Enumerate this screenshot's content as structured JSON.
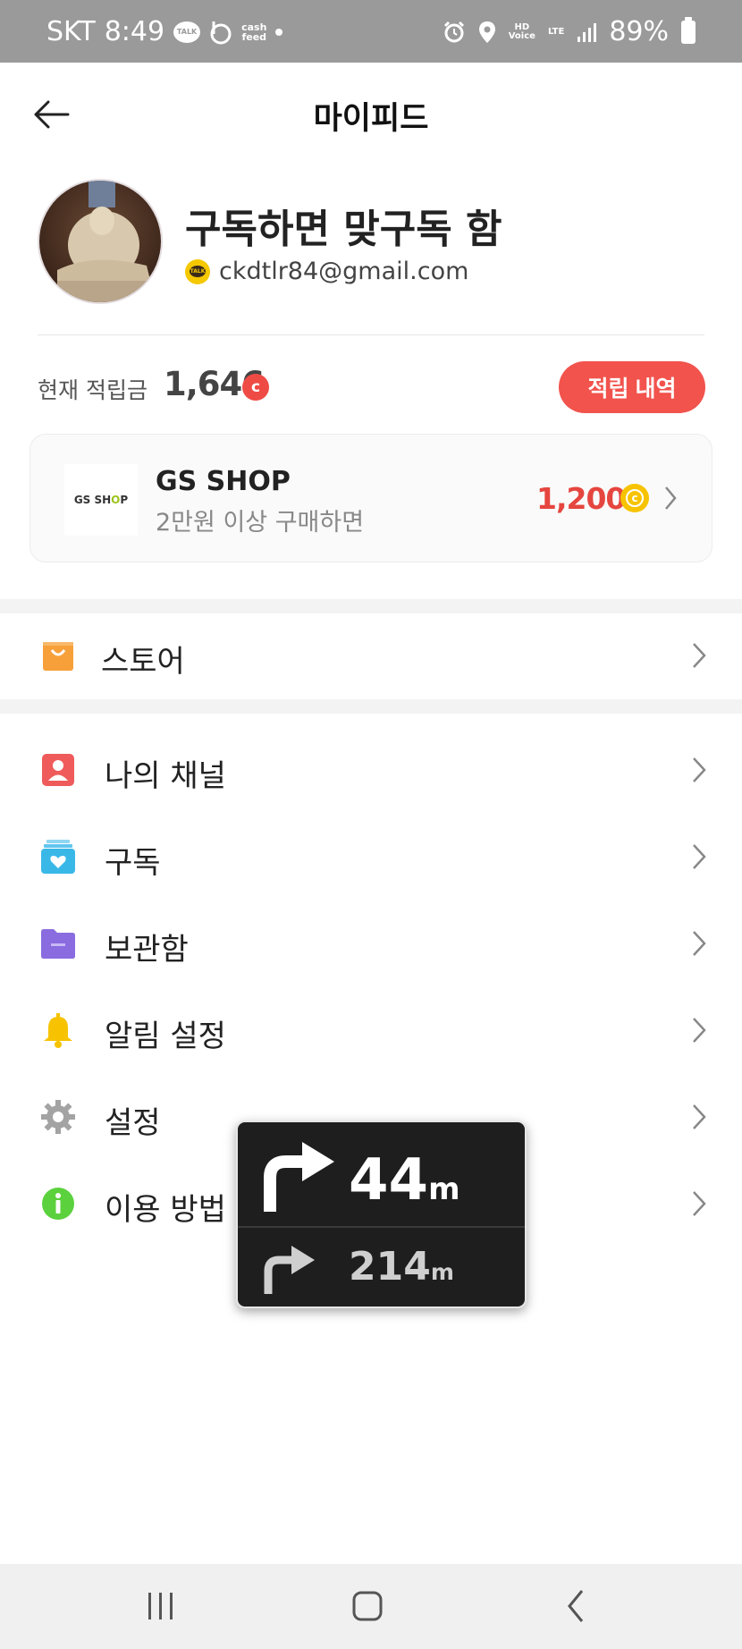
{
  "status_bar": {
    "carrier": "SKT",
    "time": "8:49",
    "talk_icon_text": "TALK",
    "cashfeed_text": "cash\nfeed",
    "hd_voice": "HD Voice",
    "network": "LTE",
    "battery": "89%"
  },
  "header": {
    "title": "마이피드"
  },
  "profile": {
    "name": "구독하면 맞구독 함",
    "talk_badge": "TALK",
    "email": "ckdtlr84@gmail.com"
  },
  "points": {
    "label": "현재 적립금",
    "value": "1,646",
    "coin_symbol": "c",
    "history_button": "적립 내역"
  },
  "promo_card": {
    "logo_text_1": "GS SH",
    "logo_text_2": "O",
    "logo_text_3": "P",
    "shop_name": "GS SHOP",
    "description": "2만원 이상 구매하면",
    "reward": "1,200",
    "coin_symbol": "c"
  },
  "store": {
    "label": "스토어",
    "icon": "shopping-bag-icon",
    "color": "#f7a03a"
  },
  "menu": [
    {
      "label": "나의 채널",
      "icon": "person-icon",
      "color": "#ef5b5b"
    },
    {
      "label": "구독",
      "icon": "subscription-heart-icon",
      "color": "#39b8e8"
    },
    {
      "label": "보관함",
      "icon": "folder-icon",
      "color": "#8a6be0"
    },
    {
      "label": "알림 설정",
      "icon": "bell-icon",
      "color": "#f7c300"
    },
    {
      "label": "설정",
      "icon": "gear-icon",
      "color": "#a3a3a3"
    },
    {
      "label": "이용 방법",
      "icon": "info-icon",
      "color": "#5bd13d"
    }
  ],
  "nav_overlay": {
    "distance_1": "44",
    "unit_1": "m",
    "distance_2": "214",
    "unit_2": "m"
  },
  "colors": {
    "accent_red": "#f2534d",
    "status_bar": "#9a9a9a"
  }
}
